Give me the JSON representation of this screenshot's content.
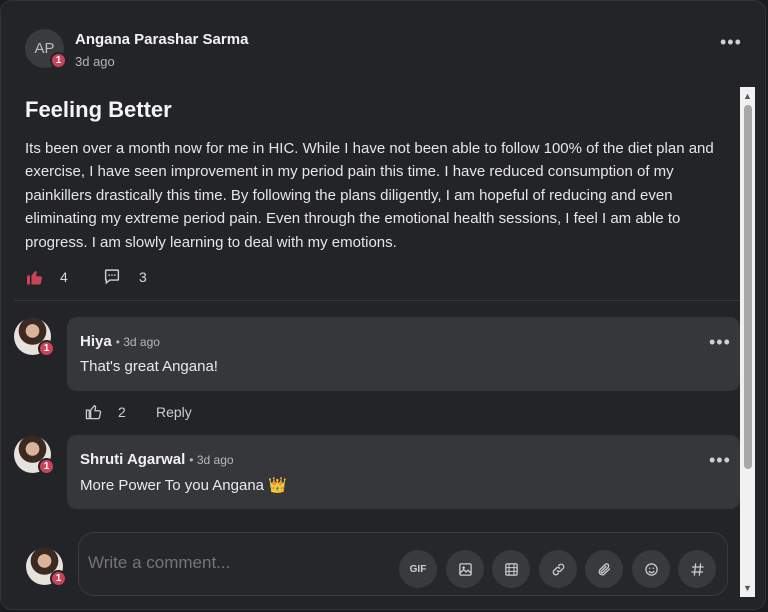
{
  "post": {
    "author_initials": "AP",
    "author_name": "Angana Parashar Sarma",
    "time": "3d ago",
    "badge": "1",
    "menu": "•••",
    "title": "Feeling Better",
    "body": "Its been over a month now for me in HIC. While I have not been able to follow 100% of the diet plan and exercise, I have seen improvement in my period pain this time. I have reduced consumption of my painkillers drastically this time. By following the plans diligently, I am hopeful of reducing and even eliminating my extreme period pain. Even through the emotional health sessions, I feel I am able to progress. I am slowly learning to deal with my emotions.",
    "likes": "4",
    "comments": "3"
  },
  "comments": [
    {
      "name": "Hiya",
      "time": "• 3d ago",
      "text": "That's great Angana!",
      "badge": "1",
      "likes": "2",
      "reply_label": "Reply",
      "menu": "•••"
    },
    {
      "name": "Shruti Agarwal",
      "time": "• 3d ago",
      "text": "More Power To you Angana 👑",
      "badge": "1",
      "menu": "•••"
    }
  ],
  "composer": {
    "placeholder": "Write a comment...",
    "badge": "1",
    "tools": [
      "GIF",
      "image-icon",
      "film-icon",
      "link-icon",
      "attachment-icon",
      "emoji-icon",
      "hashtag-icon"
    ],
    "gif_label": "GIF"
  },
  "colors": {
    "like_accent": "#c94359",
    "badge": "#c94359",
    "background": "#232427"
  }
}
